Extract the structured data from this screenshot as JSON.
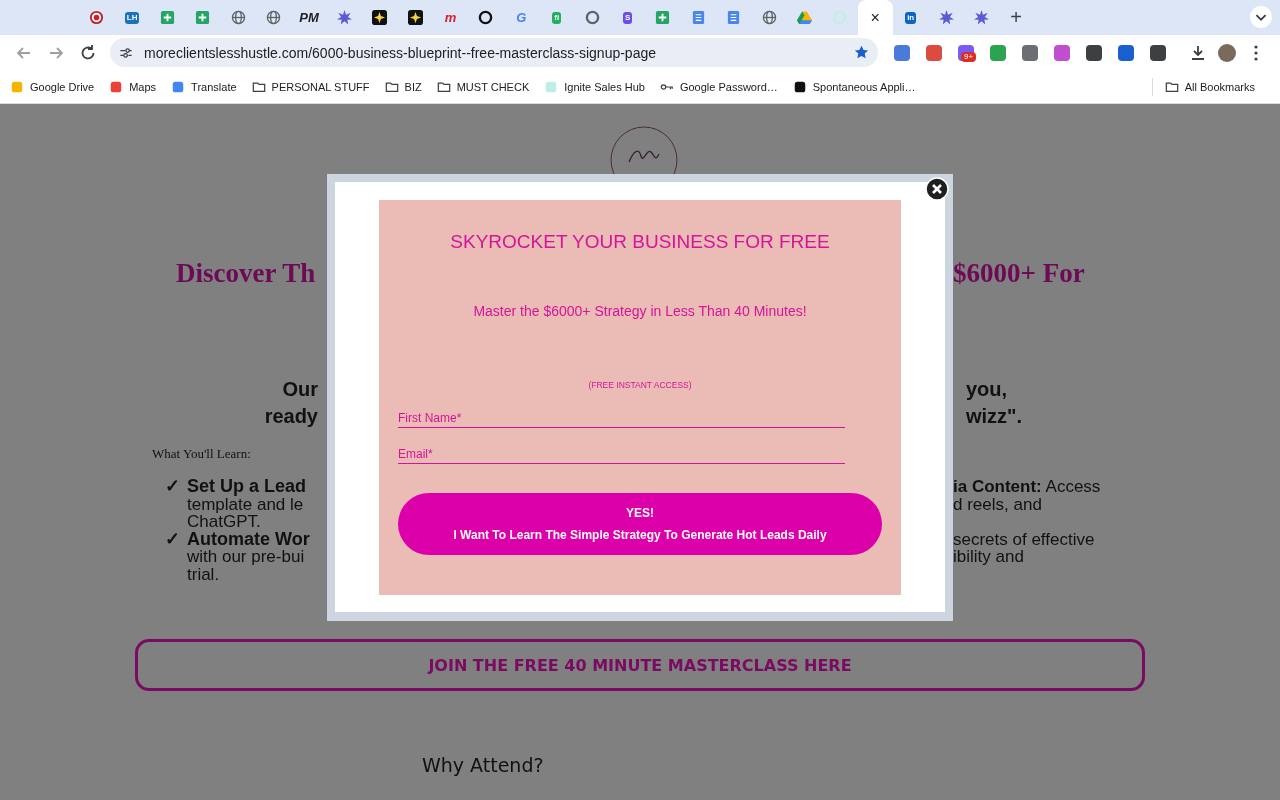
{
  "browser": {
    "tabs": [
      {
        "kind": "record",
        "color": "#c4222b",
        "selected": false
      },
      {
        "kind": "glyph",
        "color": "#1a73b8",
        "glyph": "LH",
        "selected": false
      },
      {
        "kind": "plus",
        "color": "#23a566",
        "selected": false
      },
      {
        "kind": "plus",
        "color": "#23a566",
        "selected": false
      },
      {
        "kind": "globe",
        "color": "#5f6368",
        "selected": false
      },
      {
        "kind": "globe",
        "color": "#5f6368",
        "selected": false
      },
      {
        "kind": "text",
        "color": "#202124",
        "glyph": "PM",
        "selected": false
      },
      {
        "kind": "sparkle",
        "color": "#5b5bd6",
        "selected": false
      },
      {
        "kind": "star",
        "color": "#111111",
        "selected": false
      },
      {
        "kind": "star",
        "color": "#111111",
        "selected": false
      },
      {
        "kind": "text",
        "color": "#d3202f",
        "glyph": "m",
        "selected": false
      },
      {
        "kind": "ring",
        "color": "#111111",
        "selected": false
      },
      {
        "kind": "text",
        "color": "#4285f4",
        "glyph": "G",
        "selected": false
      },
      {
        "kind": "glyph",
        "color": "#21b15d",
        "glyph": "fi",
        "selected": false
      },
      {
        "kind": "ring",
        "color": "#5f6368",
        "selected": false
      },
      {
        "kind": "glyph",
        "color": "#6b4ee6",
        "glyph": "S",
        "selected": false
      },
      {
        "kind": "plus",
        "color": "#23a566",
        "selected": false
      },
      {
        "kind": "doc",
        "color": "#4a86e8",
        "selected": false
      },
      {
        "kind": "doc",
        "color": "#4a86e8",
        "selected": false
      },
      {
        "kind": "globe",
        "color": "#5f6368",
        "selected": false
      },
      {
        "kind": "drive",
        "color": "#f4b400",
        "selected": false
      },
      {
        "kind": "ring",
        "color": "#c5ede0",
        "selected": false
      },
      {
        "kind": "close",
        "glyph": "×",
        "selected": true
      },
      {
        "kind": "glyph",
        "color": "#0a66c2",
        "glyph": "in",
        "selected": false
      },
      {
        "kind": "sparkle",
        "color": "#5b5bd6",
        "selected": false
      },
      {
        "kind": "sparkle",
        "color": "#5b5bd6",
        "selected": false
      }
    ],
    "new_tab": "+",
    "url": "moreclientslesshustle.com/6000-business-blueprint--free-masterclass-signup-page",
    "extensions": [
      {
        "color": "#4a7bd8"
      },
      {
        "color": "#db4c3f"
      },
      {
        "color": "#7a5af8",
        "badge": "9+"
      },
      {
        "color": "#2aa44f"
      },
      {
        "color": "#6b6f75"
      },
      {
        "color": "#c04fd0"
      },
      {
        "color": "#3c4043"
      },
      {
        "color": "#1a5fd0"
      },
      {
        "color": "#3c4043"
      }
    ],
    "bookmarks": [
      {
        "kind": "site",
        "label": "Google Drive",
        "color": "#f4b400"
      },
      {
        "kind": "site",
        "label": "Maps",
        "color": "#ea4335"
      },
      {
        "kind": "site",
        "label": "Translate",
        "color": "#4285f4"
      },
      {
        "kind": "folder",
        "label": "PERSONAL STUFF"
      },
      {
        "kind": "folder",
        "label": "BIZ"
      },
      {
        "kind": "folder",
        "label": "MUST CHECK"
      },
      {
        "kind": "site",
        "label": "Ignite Sales Hub",
        "color": "#bfeee6"
      },
      {
        "kind": "key",
        "label": "Google Password…"
      },
      {
        "kind": "site",
        "label": "Spontaneous Appli…",
        "color": "#111111"
      }
    ],
    "all_bookmarks": "All Bookmarks"
  },
  "page": {
    "heading_left": "Discover Th",
    "heading_right": "$6000+ For",
    "intro_left": [
      "Our",
      "ready"
    ],
    "intro_right": [
      "you,",
      "wizz\"."
    ],
    "learn_title": "What You'll Learn:",
    "learn_left": [
      {
        "mark": "✓",
        "title": "Set Up a Lead",
        "lines": [
          "template and le",
          "ChatGPT."
        ]
      },
      {
        "mark": "✓",
        "title": "Automate Wor",
        "lines": [
          "with our pre-bui",
          "trial."
        ]
      }
    ],
    "learn_right": [
      {
        "lines": [
          "**ia Content:** Access",
          "d reels, and"
        ]
      },
      {
        "lines": [
          "secrets of effective",
          "ibility and"
        ]
      }
    ],
    "cta": "JOIN THE FREE 40 MINUTE MASTERCLASS HERE",
    "why": "Why Attend?"
  },
  "popup": {
    "title": "SKYROCKET YOUR BUSINESS FOR FREE",
    "subtitle": "Master the $6000+ Strategy in Less Than 40 Minutes!",
    "note": "(FREE INSTANT ACCESS)",
    "fields": [
      {
        "placeholder": "First Name*"
      },
      {
        "placeholder": "Email*"
      }
    ],
    "button": [
      "YES!",
      "I Want To Learn The Simple Strategy To Generate Hot Leads Daily"
    ]
  }
}
